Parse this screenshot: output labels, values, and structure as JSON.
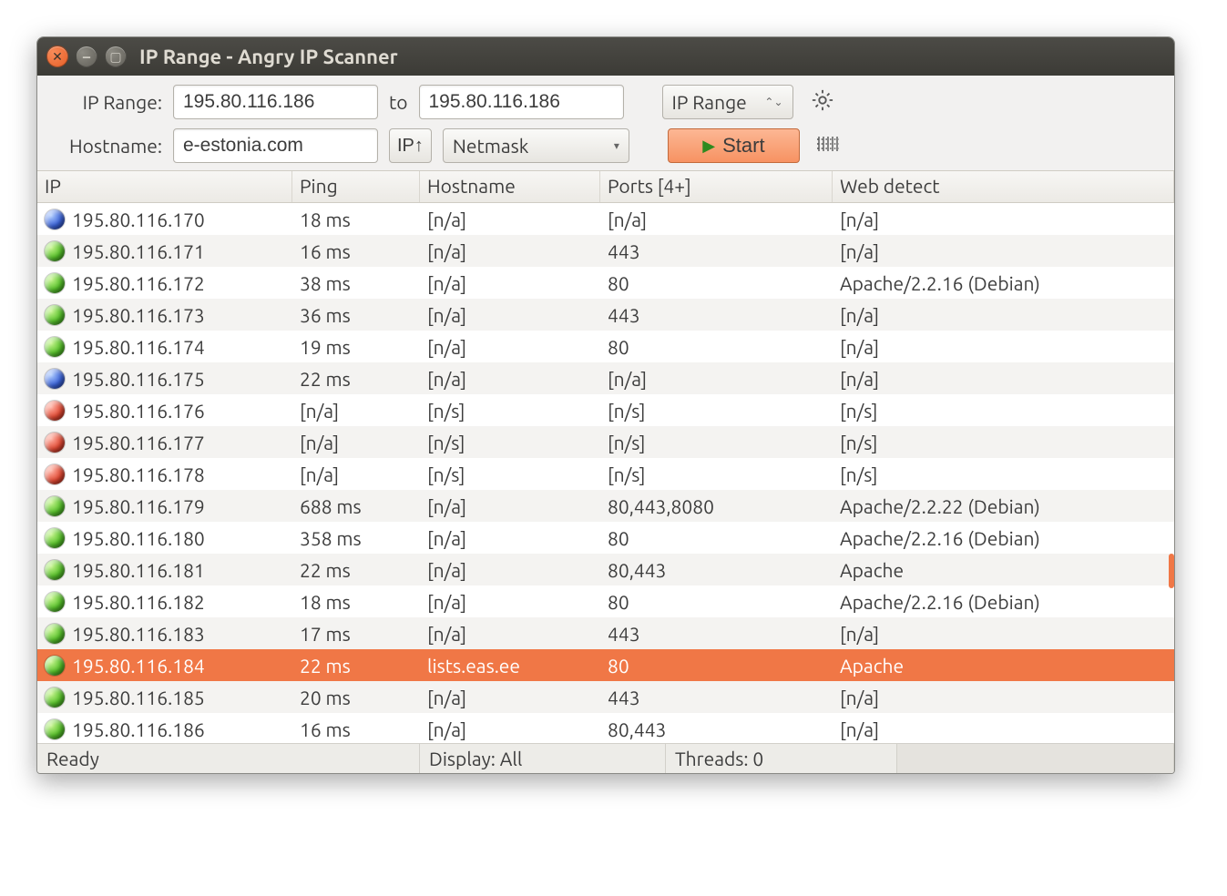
{
  "window": {
    "title": "IP Range - Angry IP Scanner"
  },
  "toolbar": {
    "ip_range_label": "IP Range:",
    "ip_from": "195.80.116.186",
    "to_label": "to",
    "ip_to": "195.80.116.186",
    "feeder_combo": "IP Range",
    "hostname_label": "Hostname:",
    "hostname": "e-estonia.com",
    "ip_up_button": "IP↑",
    "netmask_combo": "Netmask",
    "start_button": "Start"
  },
  "columns": {
    "ip": "IP",
    "ping": "Ping",
    "hostname": "Hostname",
    "ports": "Ports [4+]",
    "web": "Web detect"
  },
  "rows": [
    {
      "status": "blue",
      "ip": "195.80.116.170",
      "ping": "18 ms",
      "hostname": "[n/a]",
      "ports": "[n/a]",
      "web": "[n/a]"
    },
    {
      "status": "green",
      "ip": "195.80.116.171",
      "ping": "16 ms",
      "hostname": "[n/a]",
      "ports": "443",
      "web": "[n/a]"
    },
    {
      "status": "green",
      "ip": "195.80.116.172",
      "ping": "38 ms",
      "hostname": "[n/a]",
      "ports": "80",
      "web": "Apache/2.2.16 (Debian)"
    },
    {
      "status": "green",
      "ip": "195.80.116.173",
      "ping": "36 ms",
      "hostname": "[n/a]",
      "ports": "443",
      "web": "[n/a]"
    },
    {
      "status": "green",
      "ip": "195.80.116.174",
      "ping": "19 ms",
      "hostname": "[n/a]",
      "ports": "80",
      "web": "[n/a]"
    },
    {
      "status": "blue",
      "ip": "195.80.116.175",
      "ping": "22 ms",
      "hostname": "[n/a]",
      "ports": "[n/a]",
      "web": "[n/a]"
    },
    {
      "status": "red",
      "ip": "195.80.116.176",
      "ping": "[n/a]",
      "hostname": "[n/s]",
      "ports": "[n/s]",
      "web": "[n/s]"
    },
    {
      "status": "red",
      "ip": "195.80.116.177",
      "ping": "[n/a]",
      "hostname": "[n/s]",
      "ports": "[n/s]",
      "web": "[n/s]"
    },
    {
      "status": "red",
      "ip": "195.80.116.178",
      "ping": "[n/a]",
      "hostname": "[n/s]",
      "ports": "[n/s]",
      "web": "[n/s]"
    },
    {
      "status": "green",
      "ip": "195.80.116.179",
      "ping": "688 ms",
      "hostname": "[n/a]",
      "ports": "80,443,8080",
      "web": "Apache/2.2.22 (Debian)"
    },
    {
      "status": "green",
      "ip": "195.80.116.180",
      "ping": "358 ms",
      "hostname": "[n/a]",
      "ports": "80",
      "web": "Apache/2.2.16 (Debian)"
    },
    {
      "status": "green",
      "ip": "195.80.116.181",
      "ping": "22 ms",
      "hostname": "[n/a]",
      "ports": "80,443",
      "web": "Apache"
    },
    {
      "status": "green",
      "ip": "195.80.116.182",
      "ping": "18 ms",
      "hostname": "[n/a]",
      "ports": "80",
      "web": "Apache/2.2.16 (Debian)"
    },
    {
      "status": "green",
      "ip": "195.80.116.183",
      "ping": "17 ms",
      "hostname": "[n/a]",
      "ports": "443",
      "web": "[n/a]"
    },
    {
      "status": "green",
      "ip": "195.80.116.184",
      "ping": "22 ms",
      "hostname": "lists.eas.ee",
      "ports": "80",
      "web": "Apache",
      "selected": true
    },
    {
      "status": "green",
      "ip": "195.80.116.185",
      "ping": "20 ms",
      "hostname": "[n/a]",
      "ports": "443",
      "web": "[n/a]"
    },
    {
      "status": "green",
      "ip": "195.80.116.186",
      "ping": "16 ms",
      "hostname": "[n/a]",
      "ports": "80,443",
      "web": "[n/a]"
    }
  ],
  "statusbar": {
    "ready": "Ready",
    "display": "Display: All",
    "threads": "Threads: 0"
  }
}
